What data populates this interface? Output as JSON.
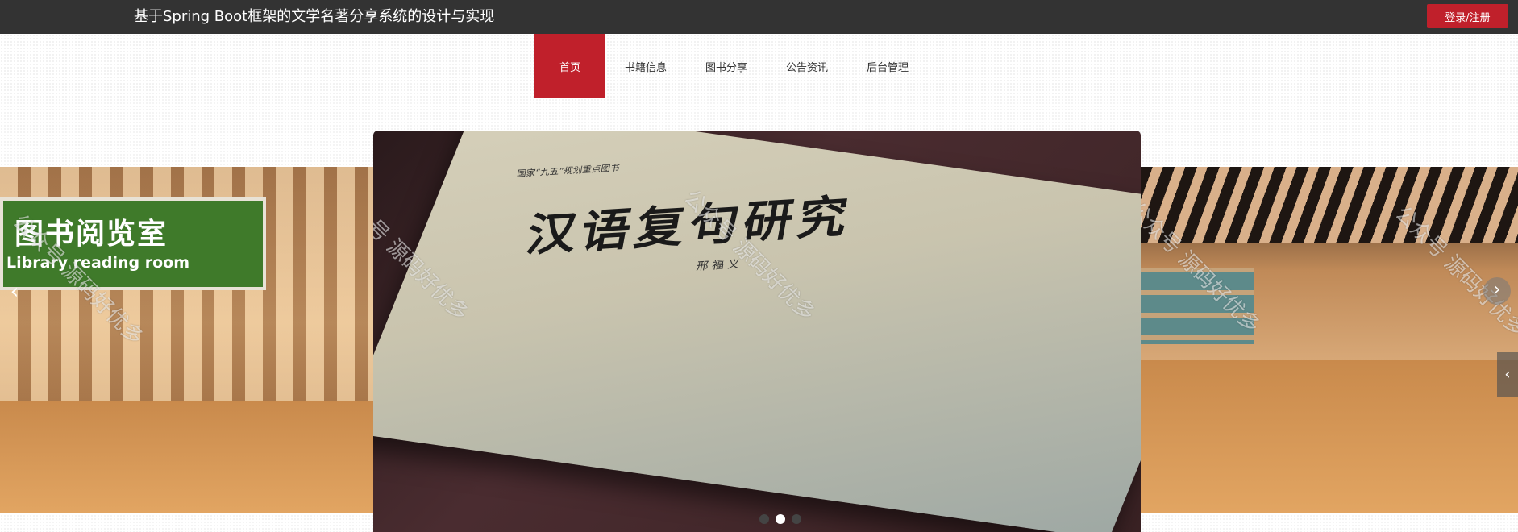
{
  "header": {
    "site_title": "基于Spring Boot框架的文学名著分享系统的设计与实现",
    "login_label": "登录/注册"
  },
  "nav": {
    "items": [
      {
        "label": "首页",
        "active": true
      },
      {
        "label": "书籍信息",
        "active": false
      },
      {
        "label": "图书分享",
        "active": false
      },
      {
        "label": "公告资讯",
        "active": false
      },
      {
        "label": "后台管理",
        "active": false
      }
    ]
  },
  "carousel": {
    "slide_left": {
      "sign_cn": "图书阅览室",
      "sign_en": "Library reading room"
    },
    "slide_center": {
      "book_series": "国家“九五”规划重点图书",
      "book_title": "汉语复句研究",
      "book_author": "邢 福 义"
    },
    "watermark_text": "公众号 源码好优多",
    "prev_icon": "chevron-left-icon",
    "next_icon": "chevron-right-icon",
    "dots_count": 3,
    "active_dot": 1
  },
  "colors": {
    "topbar": "#333333",
    "accent": "#c0202b",
    "text": "#333333"
  }
}
